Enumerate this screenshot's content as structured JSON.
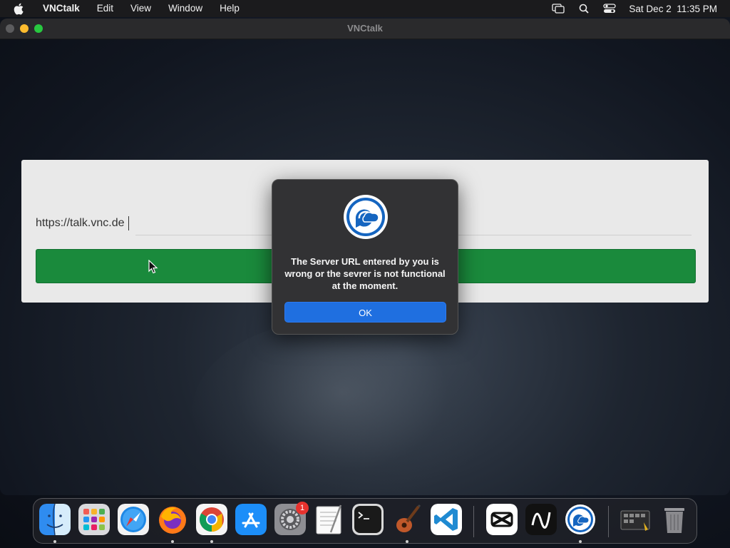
{
  "menubar": {
    "app_name": "VNCtalk",
    "menus": [
      "Edit",
      "View",
      "Window",
      "Help"
    ],
    "clock": "Sat Dec 2  11:35 PM",
    "status_icons": [
      "screen-mirror-icon",
      "search-icon",
      "control-center-icon"
    ]
  },
  "window": {
    "title": "VNCtalk"
  },
  "login": {
    "server_url": "https://talk.vnc.de"
  },
  "alert": {
    "message": "The Server URL entered by you is wrong or the sevrer is not functional at the moment.",
    "ok_label": "OK"
  },
  "dock": {
    "items": [
      "finder-icon",
      "launchpad-icon",
      "safari-icon",
      "firefox-icon",
      "chrome-icon",
      "app-store-icon",
      "system-settings-icon",
      "textedit-icon",
      "terminal-icon",
      "garageband-icon",
      "vscode-icon",
      "capcut-icon",
      "unknown-app-icon",
      "vnctalk-icon",
      "downloads-stack-icon",
      "trash-icon"
    ],
    "settings_badge": "1"
  },
  "colors": {
    "accent_green": "#1a8a3c",
    "alert_button_blue": "#1f6fe0"
  }
}
